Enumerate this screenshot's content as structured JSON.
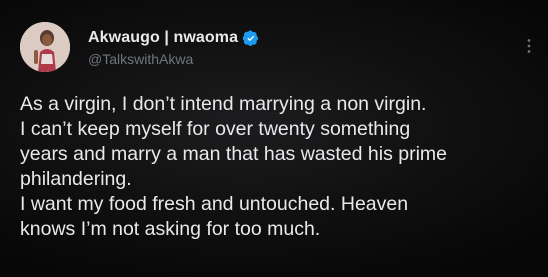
{
  "tweet": {
    "author": {
      "display_name": "Akwaugo | nwaoma",
      "handle": "@TalkswithAkwa",
      "verified": true
    },
    "icons": {
      "verified": "verified-badge-icon",
      "more": "more-options-icon",
      "avatar": "profile-avatar"
    },
    "body_lines": [
      "As a virgin, I don’t intend marrying a non virgin.",
      "I can’t keep myself for over twenty something",
      "years and marry a man that has wasted his prime",
      "philandering.",
      "I want my food fresh and untouched. Heaven",
      "knows I’m not asking for too much."
    ],
    "colors": {
      "background": "#0b0b0c",
      "text": "#e7e9ea",
      "handle": "#6e767d",
      "verified_badge": "#1d9bf0"
    }
  }
}
